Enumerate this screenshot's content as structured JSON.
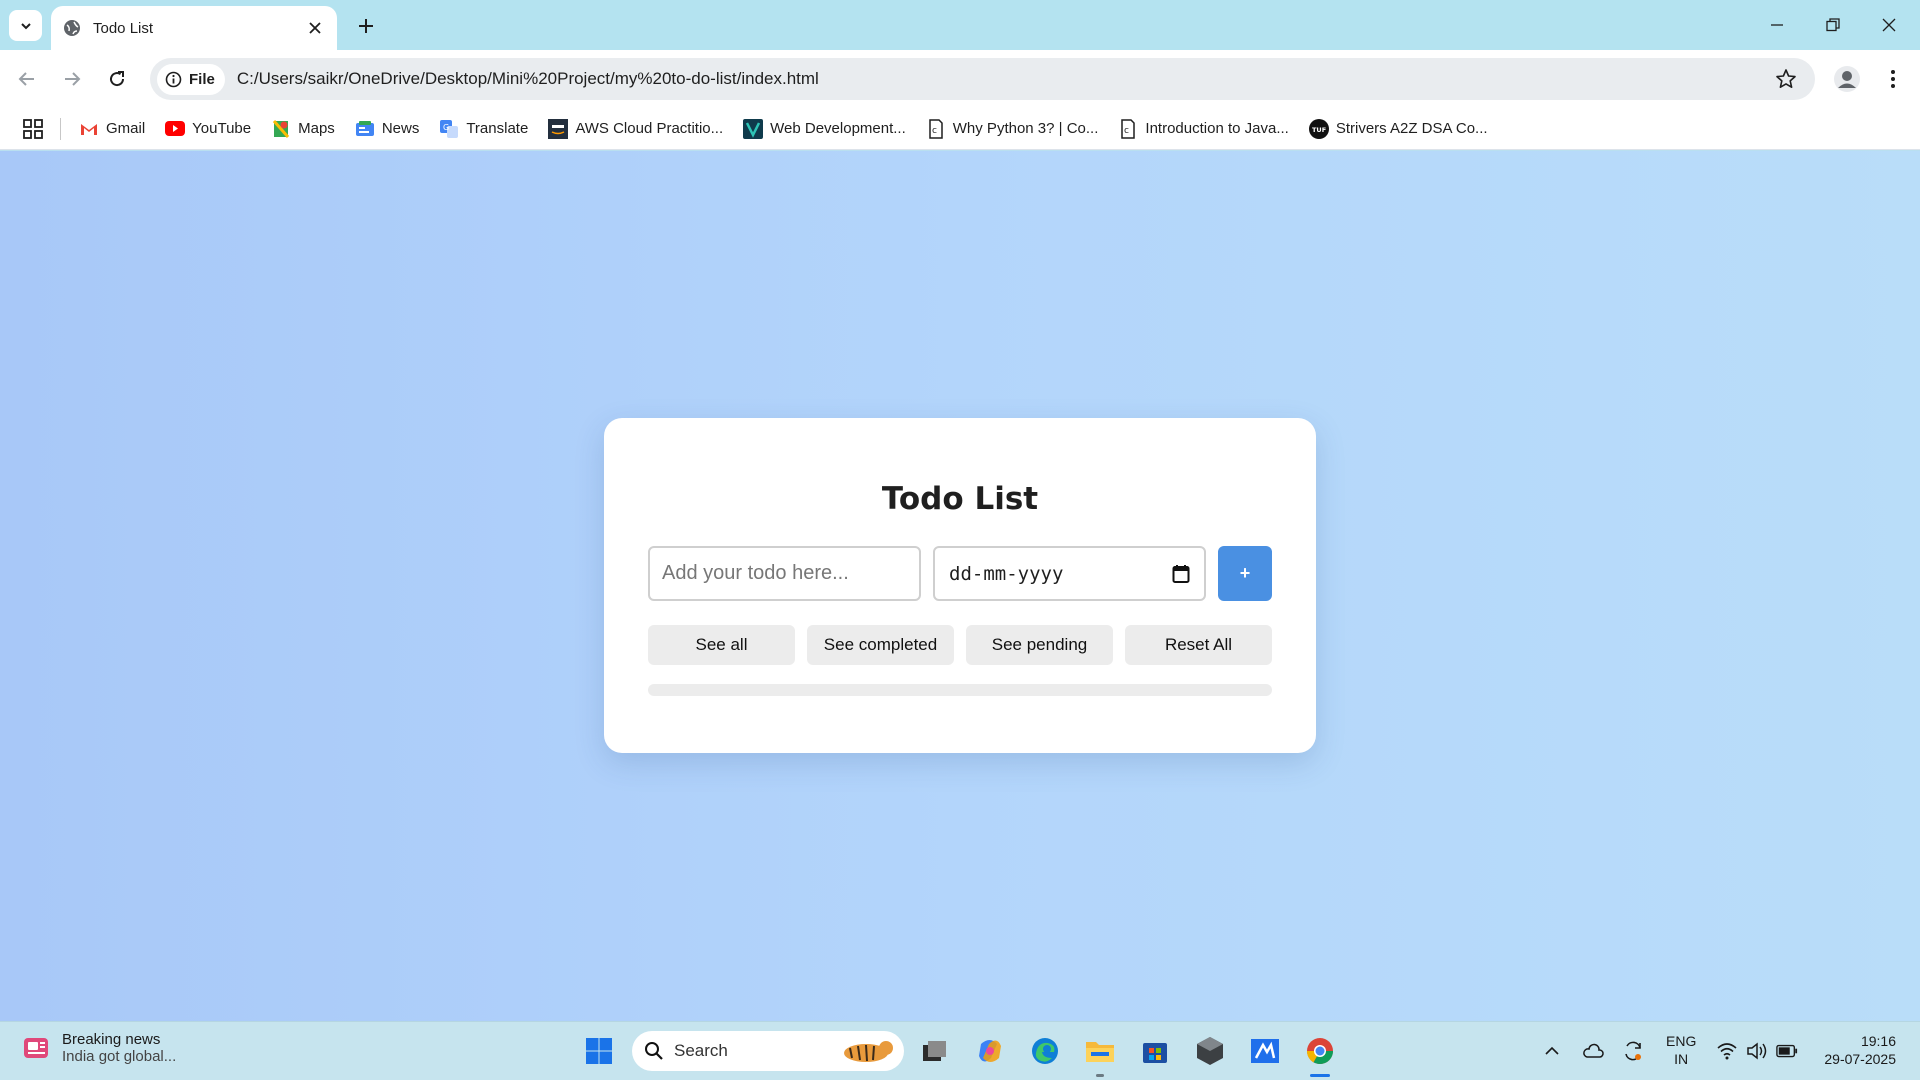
{
  "browser": {
    "tab_title": "Todo List",
    "chip_label": "File",
    "url": "C:/Users/saikr/OneDrive/Desktop/Mini%20Project/my%20to-do-list/index.html",
    "bookmarks": [
      {
        "label": "Gmail",
        "icon": "gmail-icon"
      },
      {
        "label": "YouTube",
        "icon": "youtube-icon"
      },
      {
        "label": "Maps",
        "icon": "maps-icon"
      },
      {
        "label": "News",
        "icon": "news-icon"
      },
      {
        "label": "Translate",
        "icon": "translate-icon"
      },
      {
        "label": "AWS Cloud Practitio...",
        "icon": "aws-icon"
      },
      {
        "label": "Web Development...",
        "icon": "web-dev-icon"
      },
      {
        "label": "Why Python 3? | Co...",
        "icon": "page-icon"
      },
      {
        "label": "Introduction to Java...",
        "icon": "page-icon"
      },
      {
        "label": "Strivers A2Z DSA Co...",
        "icon": "tuf-icon"
      }
    ]
  },
  "app": {
    "title": "Todo List",
    "todo_placeholder": "Add your todo here...",
    "date_placeholder": "dd-mm-yyyy",
    "add_label": "+",
    "filters": {
      "all": "See all",
      "completed": "See completed",
      "pending": "See pending",
      "reset": "Reset All"
    },
    "progress": 0,
    "accent_color": "#4a90e2"
  },
  "taskbar": {
    "news_title": "Breaking news",
    "news_sub": "India got global...",
    "search_label": "Search",
    "lang_top": "ENG",
    "lang_bottom": "IN",
    "time": "19:16",
    "date": "29-07-2025"
  }
}
